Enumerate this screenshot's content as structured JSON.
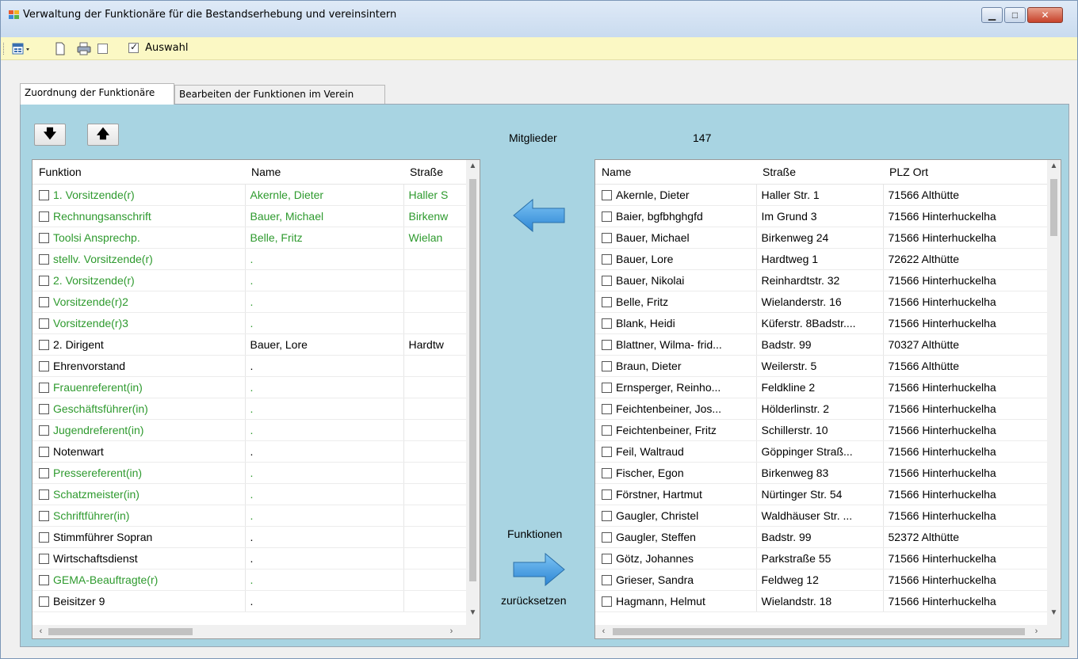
{
  "window": {
    "title": "Verwaltung der Funktionäre für die Bestandserhebung und  vereinsintern",
    "controls": {
      "minimize": "▁",
      "maximize": "□",
      "close": "✕"
    }
  },
  "toolbar": {
    "icons": [
      "export-dropdown-icon",
      "new-page-icon",
      "print-icon",
      "checkbox-unchecked"
    ],
    "auswahl_label": "Auswahl",
    "auswahl_checked": true
  },
  "tabs": [
    {
      "label": "Zuordnung der Funktionäre",
      "active": true
    },
    {
      "label": "Bearbeiten der Funktionen im Verein",
      "active": false
    }
  ],
  "center": {
    "mitglieder_label": "Mitglieder",
    "mitglieder_count": "147",
    "funktionen_label": "Funktionen",
    "zuruecksetzen_label": "zurücksetzen"
  },
  "colors": {
    "green_text": "#2e9a2e",
    "panel_bg": "#a8d4e2",
    "arrow_blue": "#3a9de0",
    "toolbar_bg": "#fbf8c4"
  },
  "left_grid": {
    "headers": [
      "Funktion",
      "Name",
      "Straße"
    ],
    "rows": [
      {
        "funktion": "1. Vorsitzende(r)",
        "name": "Akernle, Dieter",
        "strasse": "Haller S",
        "green": true
      },
      {
        "funktion": "Rechnungsanschrift",
        "name": "Bauer, Michael",
        "strasse": "Birkenw",
        "green": true
      },
      {
        "funktion": "Toolsi Ansprechp.",
        "name": "Belle, Fritz",
        "strasse": "Wielan",
        "green": true
      },
      {
        "funktion": "stellv. Vorsitzende(r)",
        "name": ".",
        "strasse": "",
        "green": true
      },
      {
        "funktion": "2. Vorsitzende(r)",
        "name": ".",
        "strasse": "",
        "green": true
      },
      {
        "funktion": "Vorsitzende(r)2",
        "name": ".",
        "strasse": "",
        "green": true
      },
      {
        "funktion": "Vorsitzende(r)3",
        "name": ".",
        "strasse": "",
        "green": true
      },
      {
        "funktion": "2. Dirigent",
        "name": "Bauer, Lore",
        "strasse": "Hardtw",
        "green": false
      },
      {
        "funktion": "Ehrenvorstand",
        "name": ".",
        "strasse": "",
        "green": false
      },
      {
        "funktion": "Frauenreferent(in)",
        "name": ".",
        "strasse": "",
        "green": true
      },
      {
        "funktion": "Geschäftsführer(in)",
        "name": ".",
        "strasse": "",
        "green": true
      },
      {
        "funktion": "Jugendreferent(in)",
        "name": ".",
        "strasse": "",
        "green": true
      },
      {
        "funktion": "Notenwart",
        "name": ".",
        "strasse": "",
        "green": false
      },
      {
        "funktion": "Pressereferent(in)",
        "name": ".",
        "strasse": "",
        "green": true
      },
      {
        "funktion": "Schatzmeister(in)",
        "name": ".",
        "strasse": "",
        "green": true
      },
      {
        "funktion": "Schriftführer(in)",
        "name": ".",
        "strasse": "",
        "green": true
      },
      {
        "funktion": "Stimmführer Sopran",
        "name": ".",
        "strasse": "",
        "green": false
      },
      {
        "funktion": "Wirtschaftsdienst",
        "name": ".",
        "strasse": "",
        "green": false
      },
      {
        "funktion": "GEMA-Beauftragte(r)",
        "name": ".",
        "strasse": "",
        "green": true
      },
      {
        "funktion": "Beisitzer 9",
        "name": ".",
        "strasse": "",
        "green": false
      }
    ]
  },
  "right_grid": {
    "headers": [
      "Name",
      "Straße",
      "PLZ Ort"
    ],
    "rows": [
      {
        "name": "Akernle, Dieter",
        "strasse": "Haller Str. 1",
        "ort": "71566 Althütte"
      },
      {
        "name": "Baier, bgfbhghgfd",
        "strasse": "Im Grund 3",
        "ort": "71566 Hinterhuckelha"
      },
      {
        "name": "Bauer, Michael",
        "strasse": "Birkenweg 24",
        "ort": "71566 Hinterhuckelha"
      },
      {
        "name": "Bauer, Lore",
        "strasse": "Hardtweg 1",
        "ort": "72622 Althütte"
      },
      {
        "name": "Bauer, Nikolai",
        "strasse": "Reinhardtstr. 32",
        "ort": "71566 Hinterhuckelha"
      },
      {
        "name": "Belle, Fritz",
        "strasse": "Wielanderstr. 16",
        "ort": "71566 Hinterhuckelha"
      },
      {
        "name": "Blank, Heidi",
        "strasse": "Küferstr. 8Badstr....",
        "ort": "71566 Hinterhuckelha"
      },
      {
        "name": "Blattner, Wilma- frid...",
        "strasse": "Badstr. 99",
        "ort": "70327 Althütte"
      },
      {
        "name": "Braun, Dieter",
        "strasse": "Weilerstr. 5",
        "ort": "71566 Althütte"
      },
      {
        "name": "Ernsperger, Reinho...",
        "strasse": "Feldkline 2",
        "ort": "71566 Hinterhuckelha"
      },
      {
        "name": "Feichtenbeiner, Jos...",
        "strasse": "Hölderlinstr. 2",
        "ort": "71566 Hinterhuckelha"
      },
      {
        "name": "Feichtenbeiner, Fritz",
        "strasse": "Schillerstr. 10",
        "ort": "71566 Hinterhuckelha"
      },
      {
        "name": "Feil, Waltraud",
        "strasse": "Göppinger Straß...",
        "ort": "71566 Hinterhuckelha"
      },
      {
        "name": "Fischer, Egon",
        "strasse": "Birkenweg 83",
        "ort": "71566 Hinterhuckelha"
      },
      {
        "name": "Förstner, Hartmut",
        "strasse": "Nürtinger Str. 54",
        "ort": "71566 Hinterhuckelha"
      },
      {
        "name": "Gaugler, Christel",
        "strasse": "Waldhäuser Str. ...",
        "ort": "71566 Hinterhuckelha"
      },
      {
        "name": "Gaugler, Steffen",
        "strasse": "Badstr. 99",
        "ort": "52372 Althütte"
      },
      {
        "name": "Götz, Johannes",
        "strasse": "Parkstraße 55",
        "ort": "71566 Hinterhuckelha"
      },
      {
        "name": "Grieser, Sandra",
        "strasse": "Feldweg 12",
        "ort": "71566 Hinterhuckelha"
      },
      {
        "name": "Hagmann, Helmut",
        "strasse": "Wielandstr. 18",
        "ort": "71566 Hinterhuckelha"
      }
    ]
  }
}
